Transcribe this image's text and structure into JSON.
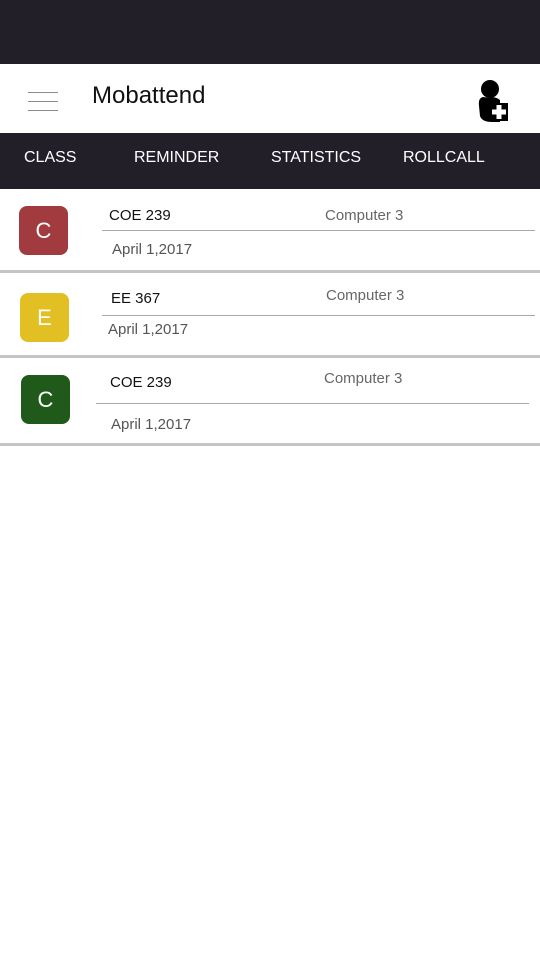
{
  "app_bar": {
    "title": "Mobattend",
    "menu_icon": "hamburger-menu-icon",
    "add_user_icon": "add-user-icon"
  },
  "tabs": [
    {
      "label": "CLASS"
    },
    {
      "label": "REMINDER"
    },
    {
      "label": "STATISTICS"
    },
    {
      "label": "ROLLCALL"
    }
  ],
  "classes": [
    {
      "initial": "C",
      "course": "COE 239",
      "room": "Computer 3",
      "date": "April 1,2017",
      "color": "#a23b3f"
    },
    {
      "initial": "E",
      "course": "EE 367",
      "room": "Computer 3",
      "date": "April 1,2017",
      "color": "#e2c023"
    },
    {
      "initial": "C",
      "course": "COE 239",
      "room": "Computer 3",
      "date": "April 1,2017",
      "color": "#1f5a1a"
    }
  ],
  "colors": {
    "dark_bar": "#221f29",
    "divider": "#a8a8a8",
    "row_separator": "#c4c4c4"
  }
}
